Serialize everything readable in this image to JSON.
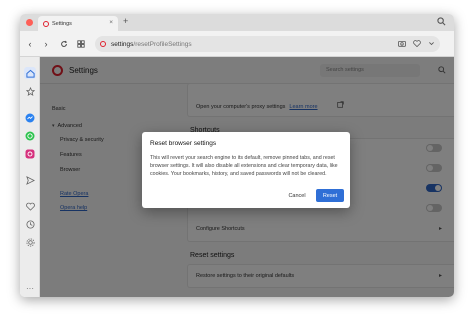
{
  "tab": {
    "title": "Settings"
  },
  "address_bar": {
    "url_host": "settings",
    "url_path": "/resetProfileSettings"
  },
  "settings_header": {
    "title": "Settings",
    "search_placeholder": "Search settings"
  },
  "left_nav": {
    "basic": "Basic",
    "advanced": "Advanced",
    "privacy": "Privacy & security",
    "features": "Features",
    "browser": "Browser",
    "rate": "Rate Opera",
    "help": "Opera help"
  },
  "main": {
    "proxy_row": "Open your computer's proxy settings",
    "proxy_link": "Learn more",
    "shortcuts_title": "Shortcuts",
    "configure_shortcuts": "Configure Shortcuts",
    "reset_title": "Reset settings",
    "restore_defaults": "Restore settings to their original defaults",
    "toggles": [
      false,
      false,
      true,
      false
    ]
  },
  "dialog": {
    "title": "Reset browser settings",
    "body": "This will revert your search engine to its default, remove pinned tabs, and reset browser settings. It will also disable all extensions and clear temporary data, like cookies. Your bookmarks, history, and saved passwords will not be cleared.",
    "cancel": "Cancel",
    "reset": "Reset"
  },
  "colors": {
    "accent": "#2f6fd6",
    "opera_red": "#e0202e"
  }
}
